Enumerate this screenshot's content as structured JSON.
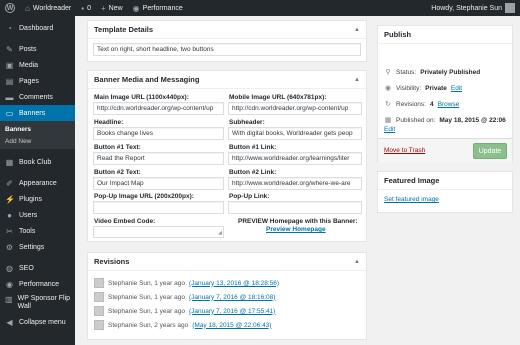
{
  "adminbar": {
    "site_name": "Worldreader",
    "comments_count": "0",
    "new_label": "New",
    "performance_label": "Performance",
    "howdy": "Howdy, Stephanie Sun"
  },
  "sidebar": {
    "items": [
      {
        "label": "Dashboard",
        "icon": "dashboard-icon"
      },
      {
        "label": "Posts",
        "icon": "pin-icon"
      },
      {
        "label": "Media",
        "icon": "media-icon"
      },
      {
        "label": "Pages",
        "icon": "page-icon"
      },
      {
        "label": "Comments",
        "icon": "comment-icon"
      },
      {
        "label": "Banners",
        "icon": "banner-icon"
      },
      {
        "label": "Book Club",
        "icon": "book-icon"
      },
      {
        "label": "Appearance",
        "icon": "brush-icon"
      },
      {
        "label": "Plugins",
        "icon": "plugin-icon"
      },
      {
        "label": "Users",
        "icon": "users-icon"
      },
      {
        "label": "Tools",
        "icon": "wrench-icon"
      },
      {
        "label": "Settings",
        "icon": "settings-icon"
      },
      {
        "label": "SEO",
        "icon": "seo-icon"
      },
      {
        "label": "Performance",
        "icon": "performance-icon"
      },
      {
        "label": "WP Sponsor Flip Wall",
        "icon": "flip-wall-icon"
      },
      {
        "label": "Collapse menu",
        "icon": "collapse-icon"
      }
    ],
    "submenu": [
      "Banners",
      "Add New"
    ]
  },
  "template": {
    "title": "Template Details",
    "value": "Text on right, short headline, two buttons"
  },
  "media": {
    "title": "Banner Media and Messaging",
    "image_label": "Main Image URL (1100x440px):",
    "image_value": "http://cdn.worldreader.org/wp-content/up",
    "mobile_label": "Mobile Image URL (640x781px):",
    "mobile_value": "http://cdn.worldreader.org/wp-content/up",
    "headline_label": "Headline:",
    "headline_value": "Books change lives",
    "subheader_label": "Subheader:",
    "subheader_value": "With digital books, Worldreader gets peop",
    "b1_text_label": "Button #1 Text:",
    "b1_text_value": "Read the Report",
    "b1_link_label": "Button #1 Link:",
    "b1_link_value": "http://www.worldreader.org/learnings/liter",
    "b2_text_label": "Button #2 Text:",
    "b2_text_value": "Our Impact Map",
    "b2_link_label": "Button #2 Link:",
    "b2_link_value": "http://www.worldreader.org/where-we-are",
    "popup_img_label": "Pop-Up Image URL (200x200px):",
    "popup_img_value": "",
    "popup_link_label": "Pop-Up Link:",
    "popup_link_value": "",
    "video_label": "Video Embed Code:",
    "preview_heading": "PREVIEW Homepage with this Banner:",
    "preview_link": "Preview Homepage"
  },
  "revisions": {
    "title": "Revisions",
    "rows": [
      {
        "text": "Stephanie Sun, 1 year ago",
        "link": "(January 13, 2016 @ 18:28:56)"
      },
      {
        "text": "Stephanie Sun, 1 year ago",
        "link": "(January 7, 2016 @ 18:16:08)"
      },
      {
        "text": "Stephanie Sun, 1 year ago",
        "link": "(January 7, 2016 @ 17:55:41)"
      },
      {
        "text": "Stephanie Sun, 2 years ago",
        "link": "(May 18, 2015 @ 22:06:43)"
      }
    ]
  },
  "publish": {
    "title": "Publish",
    "status_label": "Status:",
    "status_value": "Privately Published",
    "visibility_label": "Visibility:",
    "visibility_value": "Private",
    "edit": "Edit",
    "revisions_label": "Revisions:",
    "revisions_value": "4",
    "browse": "Browse",
    "published_label": "Published on:",
    "published_value": "May 18, 2015 @ 22:06",
    "trash": "Move to Trash",
    "update": "Update"
  },
  "featured": {
    "title": "Featured Image",
    "set_link": "Set featured image"
  },
  "colors": {
    "accent": "#0073aa",
    "sidebar_bg": "#23282d",
    "update_btn": "#8bbf8c"
  }
}
